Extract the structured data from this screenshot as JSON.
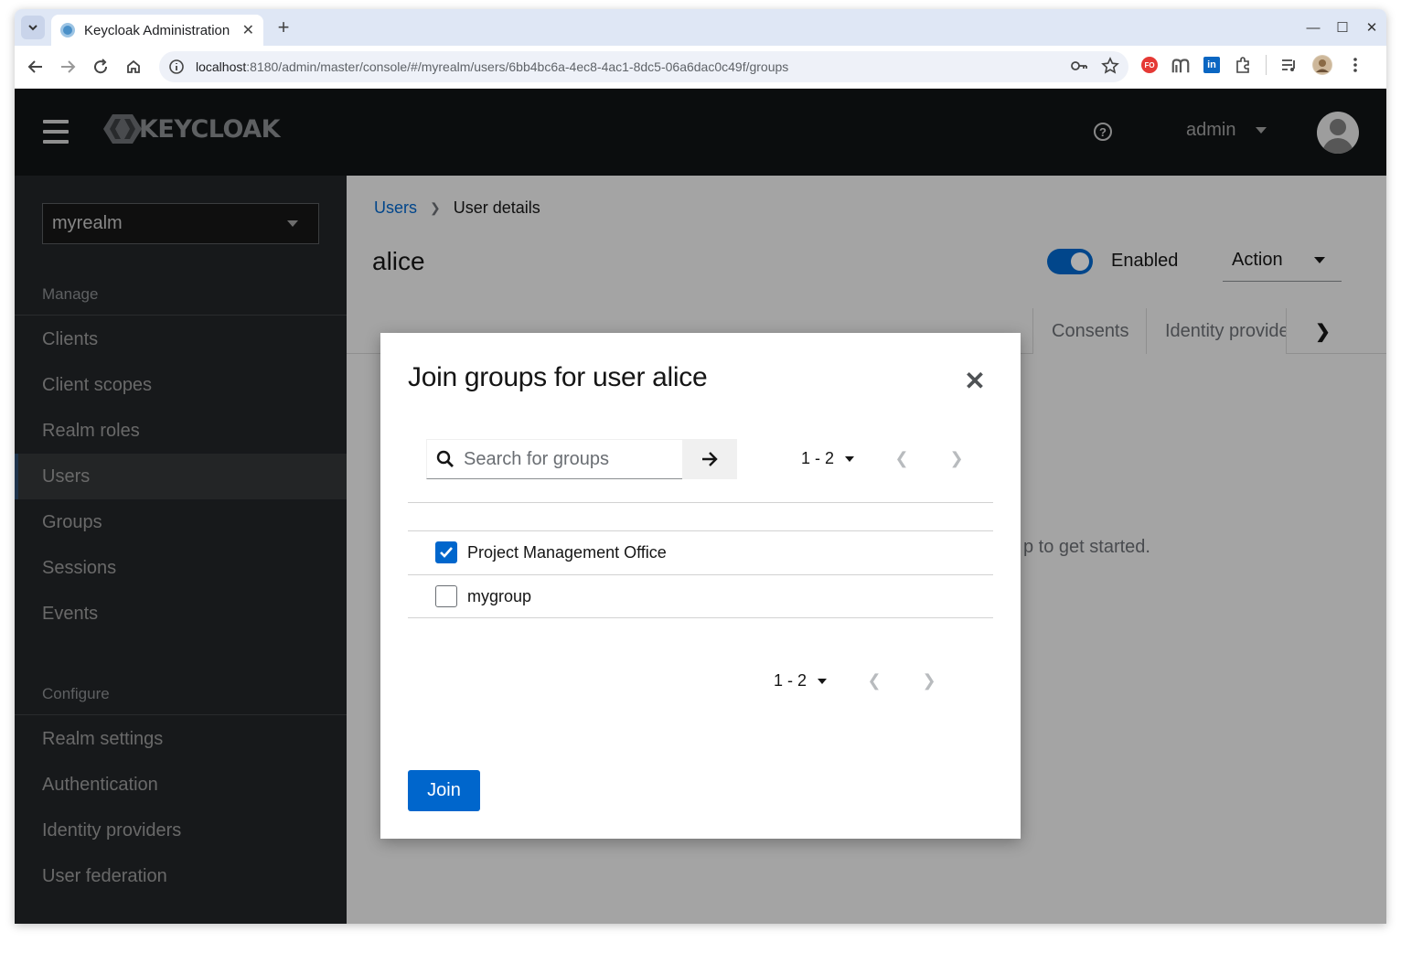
{
  "browser": {
    "tab_title": "Keycloak Administration",
    "url_host": "localhost",
    "url_path": ":8180/admin/master/console/#/myrealm/users/6bb4bc6a-4ec8-4ac1-8dc5-06a6dac0c49f/groups",
    "ext_fo": "FO"
  },
  "header": {
    "logo_text": "KEYCLOAK",
    "username": "admin"
  },
  "sidebar": {
    "realm": "myrealm",
    "manage_title": "Manage",
    "manage_items": [
      "Clients",
      "Client scopes",
      "Realm roles",
      "Users",
      "Groups",
      "Sessions",
      "Events"
    ],
    "configure_title": "Configure",
    "configure_items": [
      "Realm settings",
      "Authentication",
      "Identity providers",
      "User federation"
    ],
    "active": "Users"
  },
  "main": {
    "breadcrumb_parent": "Users",
    "breadcrumb_current": "User details",
    "page_title": "alice",
    "enabled_label": "Enabled",
    "action_label": "Action",
    "tabs": [
      "Consents",
      "Identity provider links"
    ],
    "empty_text": "p to get started."
  },
  "modal": {
    "title": "Join groups for user alice",
    "search_placeholder": "Search for groups",
    "pager_range": "1 - 2",
    "groups": [
      {
        "name": "Project Management Office",
        "checked": true
      },
      {
        "name": "mygroup",
        "checked": false
      }
    ],
    "join_label": "Join"
  },
  "colors": {
    "primary": "#0066cc",
    "header_bg": "#0f1214",
    "sidebar_bg": "#212427"
  }
}
